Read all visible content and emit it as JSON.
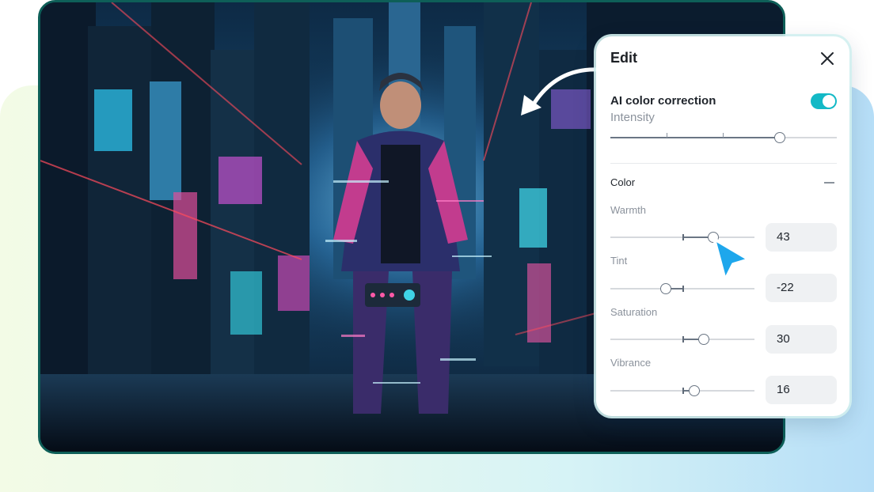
{
  "panel": {
    "title": "Edit",
    "ai": {
      "label": "AI color correction",
      "enabled": true,
      "intensity_label": "Intensity",
      "intensity_value": 0.75
    },
    "color_section": {
      "label": "Color",
      "sliders": [
        {
          "label": "Warmth",
          "value": "43"
        },
        {
          "label": "Tint",
          "value": "-22"
        },
        {
          "label": "Saturation",
          "value": "30"
        },
        {
          "label": "Vibrance",
          "value": "16"
        }
      ]
    }
  },
  "colors": {
    "accent": "#13b9c6",
    "cursor": "#1ea7ec",
    "frame": "#0e5f58"
  },
  "icons": {
    "close": "close-icon",
    "collapse": "minus-icon",
    "cursor": "pointer-cursor-icon",
    "arrow": "curved-arrow-icon"
  }
}
